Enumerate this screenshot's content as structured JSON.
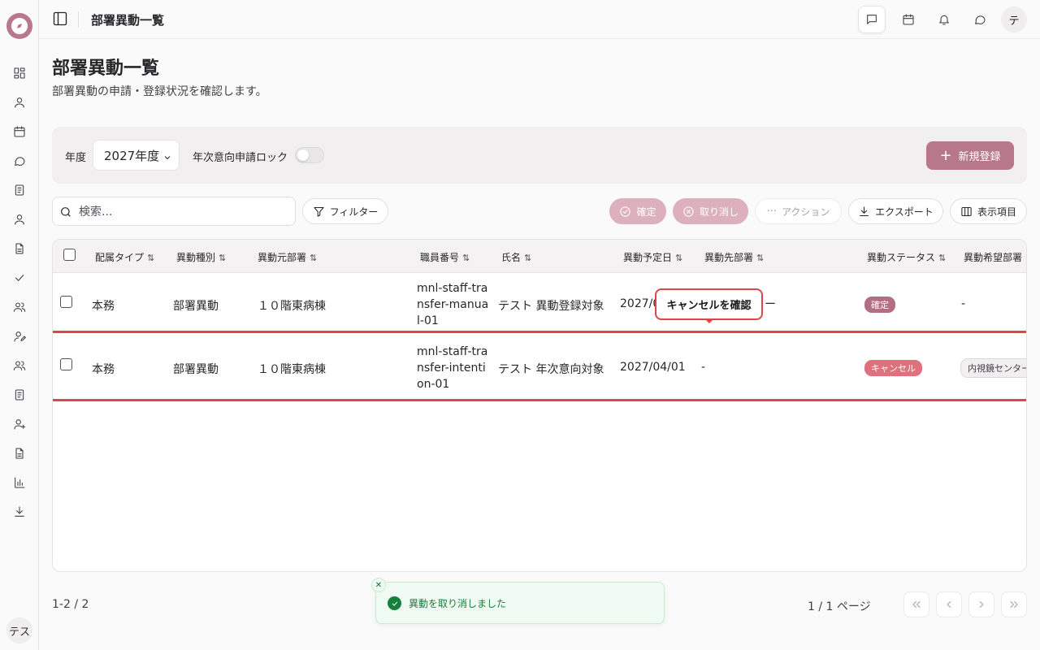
{
  "header": {
    "title": "部署異動一覧",
    "avatar_initial": "テ"
  },
  "sidebar": {
    "icons": [
      "dashboard-icon",
      "user-icon",
      "calendar-icon",
      "chat-icon",
      "document-icon",
      "user-icon",
      "file-icon",
      "check-icon",
      "users-icon",
      "user-edit-icon",
      "users-icon",
      "document-icon",
      "user-plus-icon",
      "file-icon",
      "bar-chart-icon",
      "download-icon"
    ],
    "user_label": "テス"
  },
  "page": {
    "title": "部署異動一覧",
    "subtitle": "部署異動の申請・登録状況を確認します。"
  },
  "filter": {
    "year_label": "年度",
    "year_value": "2027年度",
    "lock_label": "年次意向申請ロック",
    "lock_on": false,
    "new_button": "新規登録"
  },
  "toolbar": {
    "search_placeholder": "検索...",
    "filter_label": "フィルター",
    "confirm_label": "確定",
    "cancel_label": "取り消し",
    "action_label": "アクション",
    "export_label": "エクスポート",
    "columns_label": "表示項目"
  },
  "table": {
    "headers": [
      "配属タイプ",
      "異動種別",
      "異動元部署",
      "職員番号",
      "氏名",
      "異動予定日",
      "異動先部署",
      "異動ステータス",
      "異動希望部署"
    ],
    "rows": [
      {
        "assign_type": "本務",
        "transfer_type": "部署異動",
        "from_dept": "１０階東病棟",
        "staff_no": "mnl-staff-transfer-manual-01",
        "name": "テスト 異動登録対象",
        "date": "2027/0",
        "to_dept": "ー",
        "status": "確定",
        "wish_dept": "-"
      },
      {
        "assign_type": "本務",
        "transfer_type": "部署異動",
        "from_dept": "１０階東病棟",
        "staff_no": "mnl-staff-transfer-intention-01",
        "name": "テスト 年次意向対象",
        "date": "2027/04/01",
        "to_dept": "-",
        "status": "キャンセル",
        "wish_dept": "内視鏡センター"
      }
    ]
  },
  "tooltip": {
    "text": "キャンセルを確認"
  },
  "footer": {
    "count": "1-2 / 2",
    "page": "1 / 1 ページ"
  },
  "toast": {
    "message": "異動を取り消しました"
  },
  "colors": {
    "accent": "#b6788a",
    "danger": "#e04545",
    "success": "#15803d"
  }
}
